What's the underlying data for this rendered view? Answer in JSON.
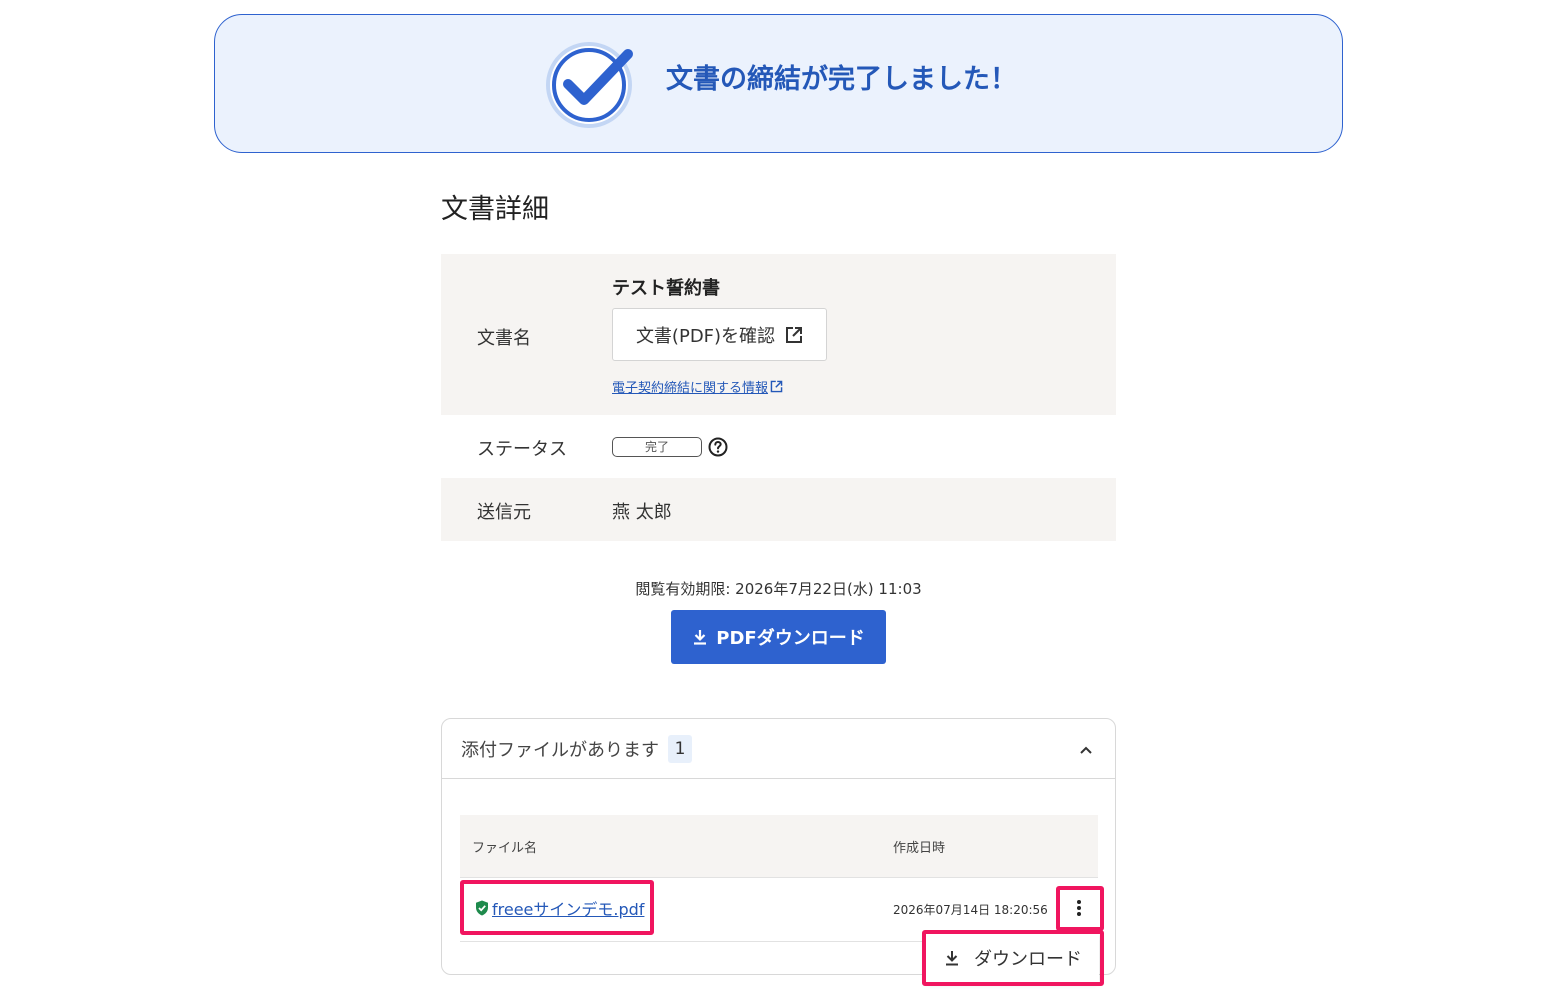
{
  "banner": {
    "message": "文書の締結が完了しました！",
    "icon": "check-circle-icon",
    "accent_color": "#2458b8",
    "background_color": "#ebf2fd"
  },
  "section": {
    "title": "文書詳細"
  },
  "details": {
    "document_name_label": "文書名",
    "document_title": "テスト誓約書",
    "view_pdf_label": "文書(PDF)を確認",
    "view_pdf_icon": "external-link-icon",
    "info_link_label": "電子契約締結に関する情報",
    "status_label": "ステータス",
    "status_value": "完了",
    "status_help_icon": "question-circle-icon",
    "sender_label": "送信元",
    "sender_value": "燕 太郎"
  },
  "download": {
    "expiry_text": "閲覧有効期限: 2026年7月22日(水) 11:03",
    "button_label": "PDFダウンロード",
    "button_icon": "download-icon",
    "button_color": "#2e62cf"
  },
  "attachments": {
    "title": "添付ファイルがあります",
    "count": "1",
    "collapse_icon": "chevron-up-icon",
    "columns": [
      "ファイル名",
      "作成日時"
    ],
    "files": [
      {
        "name": "freeeサインデモ.pdf",
        "created_at": "2026年07月14日 18:20:56",
        "verified_icon": "shield-check-icon"
      }
    ],
    "row_menu_icon": "kebab-menu-icon",
    "menu_items": [
      {
        "label": "ダウンロード",
        "icon": "download-icon"
      }
    ]
  },
  "highlight_color": "#f0155f"
}
